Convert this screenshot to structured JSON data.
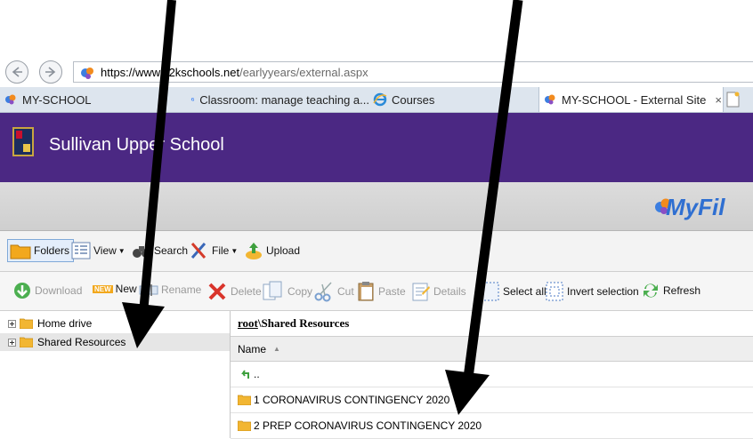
{
  "browser": {
    "url_protocol": "https://www.",
    "url_host": "c2kschools.net",
    "url_path": "/earlyyears/external.aspx",
    "tabs": [
      {
        "label": "MY-SCHOOL"
      },
      {
        "label": "Classroom: manage teaching a..."
      },
      {
        "label": "Courses"
      },
      {
        "label": "MY-SCHOOL - External Site",
        "close": "×"
      }
    ]
  },
  "site": {
    "school_name": "Sullivan Upper School",
    "brand": "MyFil"
  },
  "toolbar_main": {
    "folders": "Folders",
    "view": "View",
    "search": "Search",
    "file": "File",
    "upload": "Upload"
  },
  "toolbar_actions": {
    "download": "Download",
    "new_badge": "NEW",
    "new": "New",
    "rename": "Rename",
    "delete": "Delete",
    "copy": "Copy",
    "cut": "Cut",
    "paste": "Paste",
    "details": "Details",
    "select_all": "Select all",
    "invert_selection": "Invert selection",
    "refresh": "Refresh"
  },
  "tree": {
    "items": [
      {
        "label": "Home drive"
      },
      {
        "label": "Shared Resources"
      }
    ]
  },
  "listing": {
    "path_root": "root",
    "path_rest": "\\Shared Resources",
    "column_name": "Name",
    "up_label": "..",
    "rows": [
      {
        "label": "1 CORONAVIRUS CONTINGENCY 2020"
      },
      {
        "label": "2 PREP CORONAVIRUS CONTINGENCY 2020"
      }
    ]
  },
  "colors": {
    "header_purple": "#4b2883",
    "brand_blue": "#2f6fd1",
    "folder_yellow": "#f2b632"
  }
}
